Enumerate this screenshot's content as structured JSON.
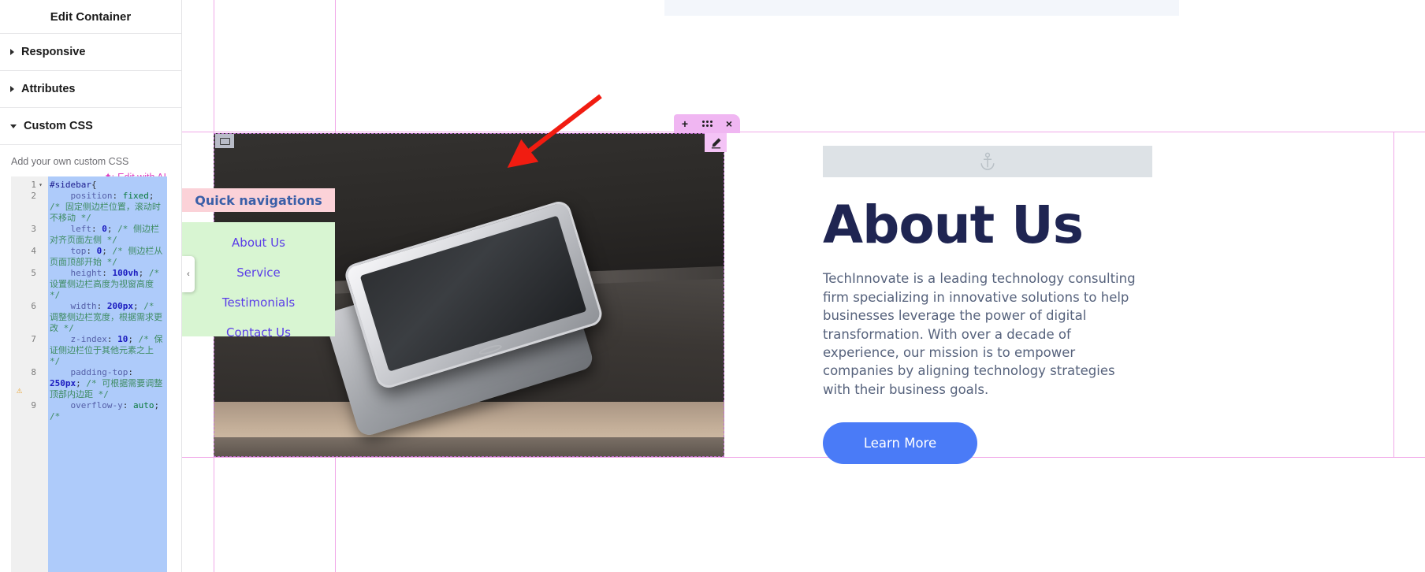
{
  "panel": {
    "title": "Edit Container",
    "sections": [
      {
        "label": "Responsive",
        "expanded": false
      },
      {
        "label": "Attributes",
        "expanded": false
      },
      {
        "label": "Custom CSS",
        "expanded": true
      }
    ],
    "custom_css_hint": "Add your own custom CSS",
    "ai_link": "Edit with AI",
    "ai_link_color": "#e040c0"
  },
  "editor": {
    "lines": [
      {
        "num": "1",
        "fold": "▾",
        "warn": ""
      },
      {
        "num": "2",
        "fold": "",
        "warn": ""
      },
      {
        "num": "3",
        "fold": "",
        "warn": ""
      },
      {
        "num": "4",
        "fold": "",
        "warn": ""
      },
      {
        "num": "5",
        "fold": "",
        "warn": ""
      },
      {
        "num": "6",
        "fold": "",
        "warn": ""
      },
      {
        "num": "7",
        "fold": "",
        "warn": ""
      },
      {
        "num": "8",
        "fold": "",
        "warn": "⚠"
      },
      {
        "num": "9",
        "fold": "",
        "warn": ""
      }
    ],
    "code": [
      {
        "selector": "#sidebar",
        "brace": "{"
      },
      {
        "prop": "position",
        "value": "fixed",
        "value_kind": "green",
        "semi": ";",
        "comment": "/* 固定侧边栏位置，滚动时不移动 */"
      },
      {
        "prop": "left",
        "value": "0",
        "value_kind": "blue",
        "semi": ";",
        "comment": "/* 侧边栏对齐页面左侧 */"
      },
      {
        "prop": "top",
        "value": "0",
        "value_kind": "blue",
        "semi": ";",
        "comment": "/* 侧边栏从页面顶部开始 */"
      },
      {
        "prop": "height",
        "value": "100vh",
        "value_kind": "blue",
        "semi": ";",
        "comment": "/* 设置侧边栏高度为视窗高度 */"
      },
      {
        "prop": "width",
        "value": "200px",
        "value_kind": "blue",
        "semi": ";",
        "comment": "/* 调整侧边栏宽度，根据需求更改 */"
      },
      {
        "prop": "z-index",
        "value": "10",
        "value_kind": "blue",
        "semi": ";",
        "comment": "/* 保证侧边栏位于其他元素之上 */"
      },
      {
        "prop": "padding-top",
        "value": "250px",
        "value_kind": "blue",
        "semi": ";",
        "comment": "/* 可根据需要调整顶部内边距 */"
      },
      {
        "prop": "overflow-y",
        "value": "auto",
        "value_kind": "green",
        "semi": ";",
        "comment": "/*"
      }
    ]
  },
  "canvas": {
    "image_chip_icon": "container-icon",
    "toolbar": {
      "add_label": "+",
      "drag_label": "drag-handle",
      "close_label": "×"
    },
    "pencil_label": "✎",
    "collapse_label": "‹",
    "quick_nav": {
      "title": "Quick navigations",
      "title_bg": "#fbd2d8",
      "list_bg": "#d8f5d2",
      "link_color": "#5a3ce8",
      "items": [
        "About Us",
        "Service",
        "Testimonials",
        "Contact Us"
      ]
    },
    "about": {
      "anchor_icon": "anchor-icon",
      "heading": "About Us",
      "paragraph": "TechInnovate is a leading technology consulting firm specializing in innovative solutions to help businesses leverage the power of digital transformation. With over a decade of experience, our mission is to empower companies by aligning technology strategies with their business goals.",
      "button_label": "Learn More",
      "button_color": "#4a7bf7",
      "heading_color": "#1f2552"
    }
  }
}
